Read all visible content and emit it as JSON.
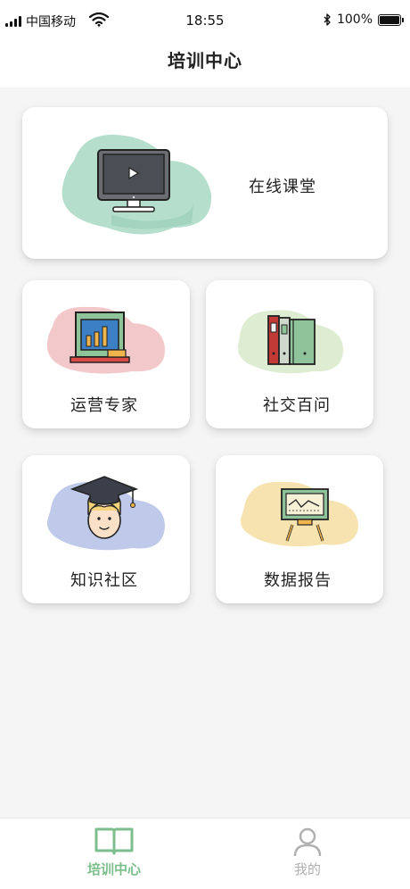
{
  "status_bar": {
    "carrier": "中国移动",
    "time": "18:55",
    "battery": "100%",
    "battery_level": 1.0
  },
  "header": {
    "title": "培训中心"
  },
  "cards": [
    {
      "id": "online-course",
      "label": "在线课堂",
      "icon": "monitor-play-icon",
      "blob_color": "#a8d8c4"
    },
    {
      "id": "operations-expert",
      "label": "运营专家",
      "icon": "bar-chart-board-icon",
      "blob_color": "#f2c2c4"
    },
    {
      "id": "social-qa",
      "label": "社交百问",
      "icon": "books-icon",
      "blob_color": "#dcebd0"
    },
    {
      "id": "knowledge-community",
      "label": "知识社区",
      "icon": "graduate-icon",
      "blob_color": "#bcc6e8"
    },
    {
      "id": "data-report",
      "label": "数据报告",
      "icon": "easel-chart-icon",
      "blob_color": "#f7e2ab"
    }
  ],
  "tab_bar": {
    "active_color": "#7cbf8c",
    "inactive_color": "#b0b0b0",
    "tabs": [
      {
        "label": "培训中心",
        "icon": "book-icon",
        "active": true
      },
      {
        "label": "我的",
        "icon": "person-icon",
        "active": false
      }
    ]
  }
}
